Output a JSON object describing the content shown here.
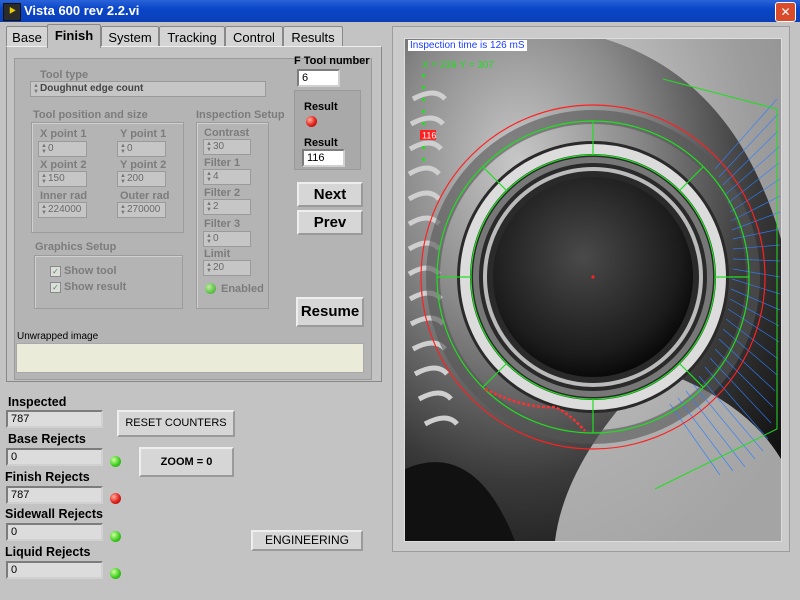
{
  "window": {
    "title": "Vista 600 rev 2.2.vi",
    "icon_glyph": "⯈",
    "close_glyph": "✕"
  },
  "tabs": [
    {
      "label": "Base"
    },
    {
      "label": "Finish"
    },
    {
      "label": "System"
    },
    {
      "label": "Tracking"
    },
    {
      "label": "Control"
    },
    {
      "label": "Results"
    }
  ],
  "active_tab": "Finish",
  "tool": {
    "type_label": "Tool type",
    "type_value": "Doughnut edge count",
    "number_label": "F Tool number",
    "number_value": "6"
  },
  "position": {
    "group_label": "Tool position and size",
    "x1_label": "X point 1",
    "x1": "0",
    "y1_label": "Y point 1",
    "y1": "0",
    "x2_label": "X point 2",
    "x2": "150",
    "y2_label": "Y point 2",
    "y2": "200",
    "inner_label": "Inner rad",
    "inner": "224000",
    "outer_label": "Outer rad",
    "outer": "270000"
  },
  "inspection_setup": {
    "group_label": "Inspection Setup",
    "contrast_label": "Contrast",
    "contrast": "30",
    "filter1_label": "Filter 1",
    "filter1": "4",
    "filter2_label": "Filter 2",
    "filter2": "2",
    "filter3_label": "Filter 3",
    "filter3": "0",
    "limit_label": "Limit",
    "limit": "20",
    "enabled_label": "Enabled"
  },
  "graphics_setup": {
    "group_label": "Graphics Setup",
    "show_tool": "Show tool",
    "show_result": "Show result"
  },
  "result": {
    "led_label": "Result",
    "value_label": "Result",
    "value": "116",
    "led_color": "#e02018"
  },
  "buttons": {
    "next": "Next",
    "prev": "Prev",
    "resume": "Resume",
    "reset": "RESET COUNTERS",
    "zoom": "ZOOM = 0",
    "engineering": "ENGINEERING"
  },
  "unwrapped": {
    "label": "Unwrapped image"
  },
  "counters": [
    {
      "label": "Inspected",
      "value": "787"
    },
    {
      "label": "Base Rejects",
      "value": "0",
      "led": "green"
    },
    {
      "label": "Finish Rejects",
      "value": "787",
      "led": "red"
    },
    {
      "label": "Sidewall Rejects",
      "value": "0",
      "led": "green"
    },
    {
      "label": "Liquid Rejects",
      "value": "0",
      "led": "green"
    }
  ],
  "image_overlay": {
    "inspection_time": "Inspection time is 126 mS",
    "coords": "X = 239  Y = 307",
    "count_tag": "116",
    "colors": {
      "tool_green": "#22dd22",
      "limit_red": "#ff2020",
      "unwrap_blue": "#2f7fff",
      "info_blue": "#1a3cff"
    }
  }
}
